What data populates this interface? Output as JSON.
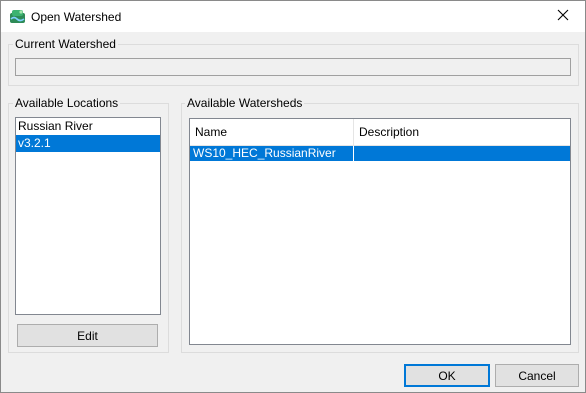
{
  "window": {
    "title": "Open Watershed",
    "close_glyph": "✕",
    "icon": "watershed-app-icon"
  },
  "current_watershed": {
    "label": "Current Watershed",
    "value": ""
  },
  "available_locations": {
    "label": "Available Locations",
    "items": [
      {
        "label": "Russian River",
        "selected": false
      },
      {
        "label": "v3.2.1",
        "selected": true
      }
    ],
    "edit_label": "Edit"
  },
  "available_watersheds": {
    "label": "Available Watersheds",
    "columns": [
      "Name",
      "Description"
    ],
    "rows": [
      {
        "name": "WS10_HEC_RussianRiver",
        "description": "",
        "selected": true
      }
    ]
  },
  "buttons": {
    "ok_label": "OK",
    "cancel_label": "Cancel"
  },
  "colors": {
    "selection": "#0078d7",
    "accent": "#0078d7"
  }
}
